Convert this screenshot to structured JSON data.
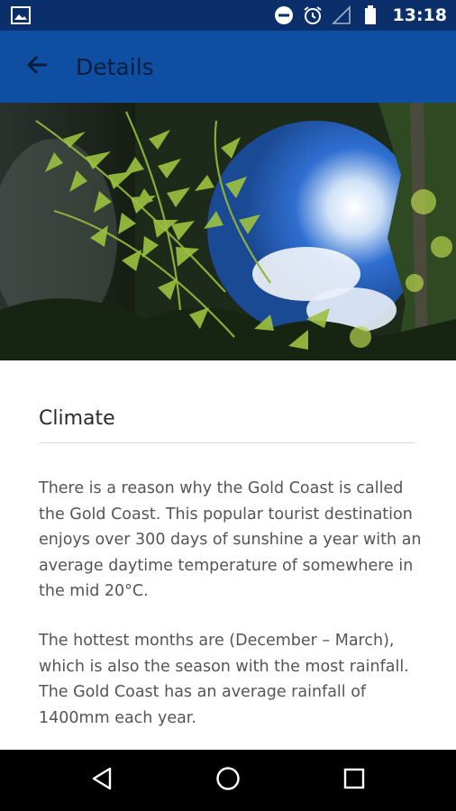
{
  "status_bar": {
    "time": "13:18",
    "icons": [
      "image-notification-icon",
      "do-not-disturb-icon",
      "alarm-icon",
      "signal-icon",
      "battery-icon"
    ]
  },
  "app_bar": {
    "title": "Details",
    "back_icon": "arrow-back-icon"
  },
  "hero": {
    "subject": "rainforest-fern-canopy-photo",
    "colors": {
      "sky": "#2f6fd1",
      "fern": "#8fb53a",
      "dark": "#1d2a1a"
    }
  },
  "content": {
    "title": "Climate",
    "paragraphs": [
      "There is a reason why the Gold Coast is called the Gold Coast. This popular tourist destination enjoys over 300 days of sunshine a year with an average daytime temperature of somewhere in the mid 20°C.",
      "The hottest months are (December – March), which is also the season with the most rainfall. The Gold Coast has an average rainfall of 1400mm each year."
    ]
  },
  "nav_bar": {
    "buttons": [
      "back-triangle-icon",
      "home-circle-icon",
      "recents-square-icon"
    ]
  },
  "colors": {
    "status_bar": "#0a2f6b",
    "app_bar": "#0e4fa3",
    "title_text": "#0a1e3c",
    "body_text": "#555555"
  }
}
